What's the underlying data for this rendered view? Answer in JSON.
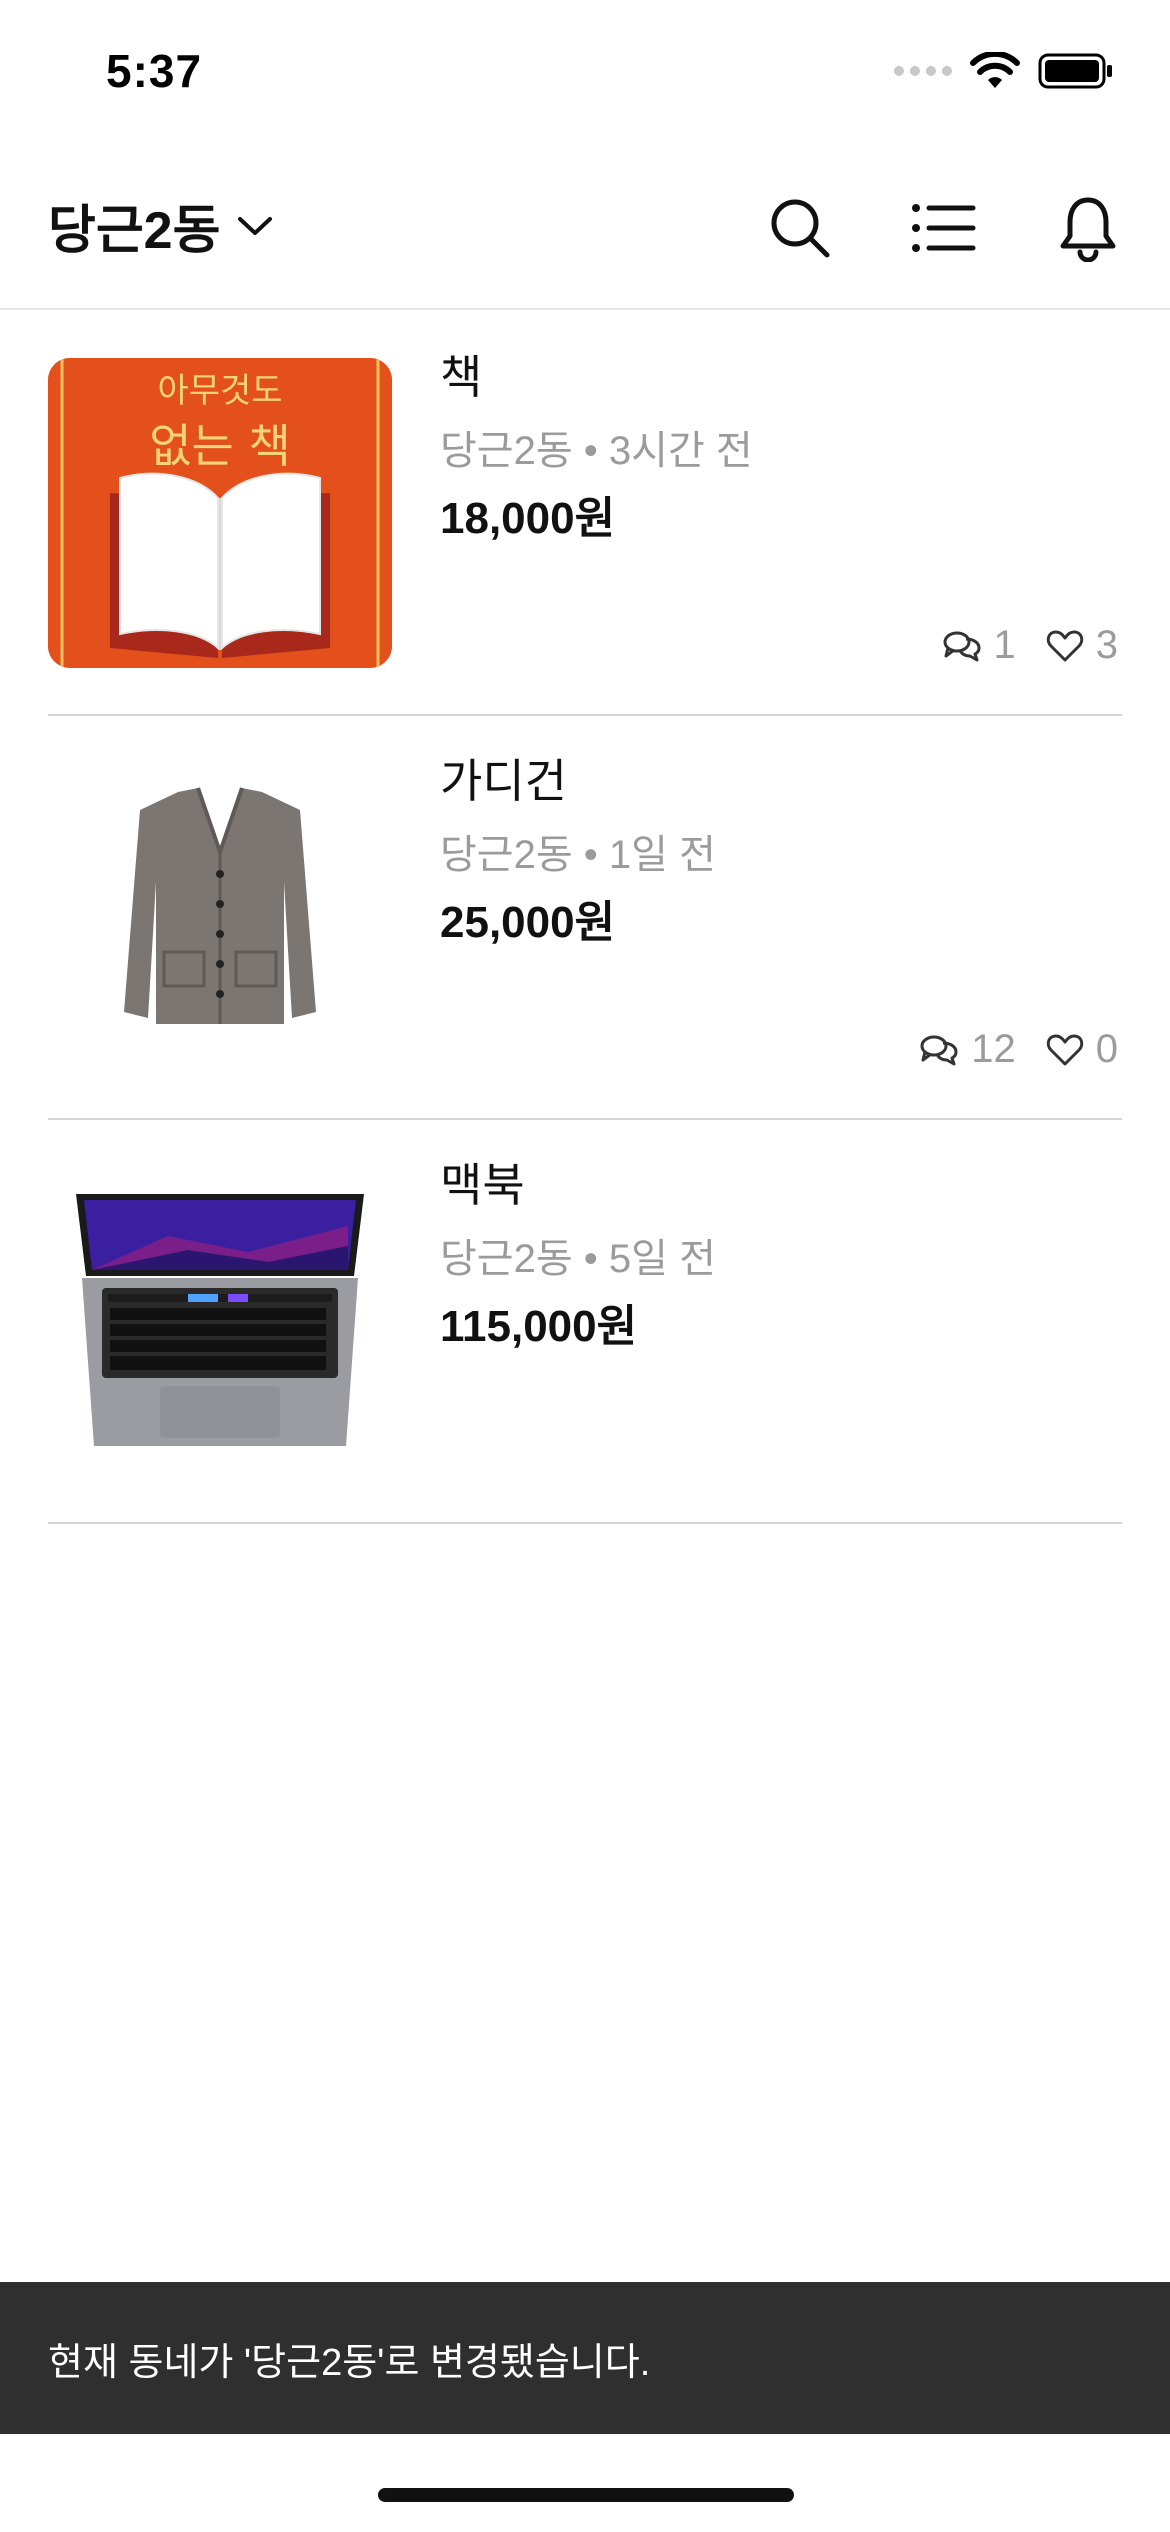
{
  "status_bar": {
    "time": "5:37"
  },
  "header": {
    "location": "당근2동",
    "icons": [
      "search-icon",
      "list-icon",
      "bell-icon"
    ]
  },
  "items": [
    {
      "title": "책",
      "location": "당근2동",
      "time": "3시간 전",
      "price": "18,000원",
      "comments": "1",
      "likes": "3",
      "image": {
        "cover_line1": "아무것도",
        "cover_line2": "없는 책"
      }
    },
    {
      "title": "가디건",
      "location": "당근2동",
      "time": "1일 전",
      "price": "25,000원",
      "comments": "12",
      "likes": "0"
    },
    {
      "title": "맥북",
      "location": "당근2동",
      "time": "5일 전",
      "price": "115,000원"
    }
  ],
  "meta_separator": "•",
  "toast": {
    "message": "현재 동네가 '당근2동'로 변경됐습니다."
  },
  "colors": {
    "accent_book": "#e4501c",
    "toast_bg": "#2f2f2f",
    "meta_gray": "#9b9b9b"
  }
}
